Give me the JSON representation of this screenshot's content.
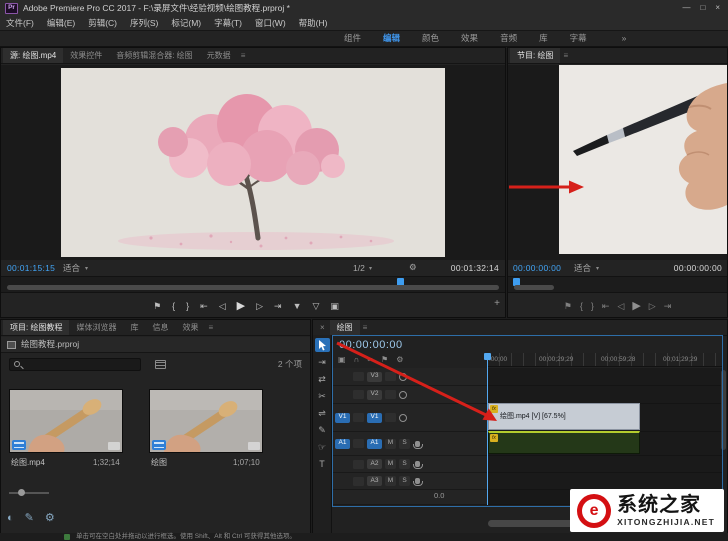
{
  "titlebar": {
    "app_badge": "Pr",
    "title": "Adobe Premiere Pro CC 2017 - F:\\录屏文件\\经验视频\\绘图教程.prproj *",
    "minimize": "—",
    "maximize": "□",
    "close": "×"
  },
  "menu": {
    "items": [
      {
        "label": "文件(F)"
      },
      {
        "label": "编辑(E)"
      },
      {
        "label": "剪辑(C)"
      },
      {
        "label": "序列(S)"
      },
      {
        "label": "标记(M)"
      },
      {
        "label": "字幕(T)"
      },
      {
        "label": "窗口(W)"
      },
      {
        "label": "帮助(H)"
      }
    ]
  },
  "workspace": {
    "tabs": [
      {
        "label": "组件"
      },
      {
        "label": "编辑"
      },
      {
        "label": "颜色"
      },
      {
        "label": "效果"
      },
      {
        "label": "音频"
      },
      {
        "label": "库"
      },
      {
        "label": "字幕"
      }
    ],
    "active": "编辑",
    "more": "»"
  },
  "source_monitor": {
    "tabs": [
      {
        "label": "源: 绘图.mp4"
      },
      {
        "label": "效果控件"
      },
      {
        "label": "音频剪辑混合器: 绘图"
      },
      {
        "label": "元数据"
      }
    ],
    "panel_menu": "≡",
    "current_time": "00:01:15:15",
    "zoom_level": "适合",
    "caret": "▾",
    "playback_resolution": "1/2",
    "settings_icon": "⚙",
    "duration": "00:01:32:14",
    "transport": [
      {
        "name": "add-marker-button",
        "glyph": "⚑"
      },
      {
        "name": "mark-in-button",
        "glyph": "{"
      },
      {
        "name": "mark-out-button",
        "glyph": "}"
      },
      {
        "name": "go-to-in-button",
        "glyph": "⇤"
      },
      {
        "name": "step-back-button",
        "glyph": "◁"
      },
      {
        "name": "play-button",
        "glyph": "▶"
      },
      {
        "name": "step-forward-button",
        "glyph": "▷"
      },
      {
        "name": "go-to-out-button",
        "glyph": "⇥"
      },
      {
        "name": "insert-button",
        "glyph": "▼"
      },
      {
        "name": "overwrite-button",
        "glyph": "▽"
      },
      {
        "name": "export-frame-button",
        "glyph": "▣"
      },
      {
        "name": "button-editor-button",
        "glyph": "+"
      }
    ]
  },
  "program_monitor": {
    "tab": "节目: 绘图",
    "panel_menu": "≡",
    "current_time": "00:00:00:00",
    "zoom_level": "适合",
    "caret": "▾",
    "duration": "00:00:00:00",
    "transport": [
      {
        "name": "add-marker-button",
        "glyph": "⚑"
      },
      {
        "name": "mark-in-button",
        "glyph": "{"
      },
      {
        "name": "mark-out-button",
        "glyph": "}"
      },
      {
        "name": "go-to-in-button",
        "glyph": "⇤"
      },
      {
        "name": "step-back-button",
        "glyph": "◁"
      },
      {
        "name": "play-button",
        "glyph": "▶"
      },
      {
        "name": "step-forward-button",
        "glyph": "▷"
      },
      {
        "name": "go-to-out-button",
        "glyph": "⇥"
      }
    ]
  },
  "project_panel": {
    "tabs": [
      {
        "label": "项目: 绘图教程"
      },
      {
        "label": "媒体浏览器"
      },
      {
        "label": "库"
      },
      {
        "label": "信息"
      },
      {
        "label": "效果"
      }
    ],
    "panel_menu": "≡",
    "project_file": "绘图教程.prproj",
    "item_count": "2 个项",
    "clips": [
      {
        "name": "绘图.mp4",
        "duration": "1;32;14"
      },
      {
        "name": "绘图",
        "duration": "1;07;10"
      }
    ],
    "footer_icons": [
      {
        "name": "contrast-icon",
        "glyph": "◐"
      },
      {
        "name": "brush-icon",
        "glyph": "✎"
      },
      {
        "name": "gear-icon",
        "glyph": "⚙"
      }
    ]
  },
  "timeline": {
    "close": "×",
    "tab": "绘图",
    "panel_menu": "≡",
    "current_time": "00:00:00:00",
    "header_icons": [
      {
        "name": "nest-insert-icon",
        "glyph": "▣"
      },
      {
        "name": "snap-magnet-icon",
        "glyph": "∩"
      },
      {
        "name": "linked-selection-icon",
        "glyph": "∞"
      },
      {
        "name": "add-marker-icon",
        "glyph": "⚑"
      },
      {
        "name": "timeline-settings-icon",
        "glyph": "⚙"
      }
    ],
    "tools": [
      {
        "name": "selection-tool"
      },
      {
        "name": "track-select-forward-tool",
        "glyph": "⇥"
      },
      {
        "name": "ripple-edit-tool",
        "glyph": "⇄"
      },
      {
        "name": "razor-tool",
        "glyph": "✂"
      },
      {
        "name": "slip-tool",
        "glyph": "⇌"
      },
      {
        "name": "pen-tool",
        "glyph": "✎"
      },
      {
        "name": "hand-tool",
        "glyph": "☞"
      },
      {
        "name": "type-tool",
        "glyph": "T"
      }
    ],
    "ruler_labels": [
      {
        "t": ":00;00"
      },
      {
        "t": "00;00;29;29"
      },
      {
        "t": "00;00;59;28"
      },
      {
        "t": "00;01;29;29"
      }
    ],
    "video_tracks": [
      {
        "id": "V3"
      },
      {
        "id": "V2"
      },
      {
        "id": "V1"
      }
    ],
    "audio_tracks": [
      {
        "id": "A1"
      },
      {
        "id": "A2"
      },
      {
        "id": "A3"
      }
    ],
    "source_patch_video": "V1",
    "source_patch_audio": "A1",
    "mute": "M",
    "solo": "S",
    "video_clip_label": "绘图.mp4 [V] [67.5%]",
    "fx_badge": "fx",
    "audio_meter": "0.0"
  },
  "status_bar": {
    "text": "单击可在空白处并拖动以进行框选。使用 Shift、Alt 和 Ctrl 可获得其他选项。"
  },
  "watermark": {
    "logo_letter": "e",
    "brand": "系统之家",
    "domain": "XITONGZHIJIA.NET"
  },
  "colors": {
    "accent_blue": "#3e9df0",
    "timecode_blue": "#42a4f5",
    "selection_blue": "#2a6db3",
    "clip_video_gray": "#c6ccd4",
    "clip_audio_green": "#243818",
    "arrow_red": "#d6201a",
    "watermark_red": "#d40f12"
  }
}
